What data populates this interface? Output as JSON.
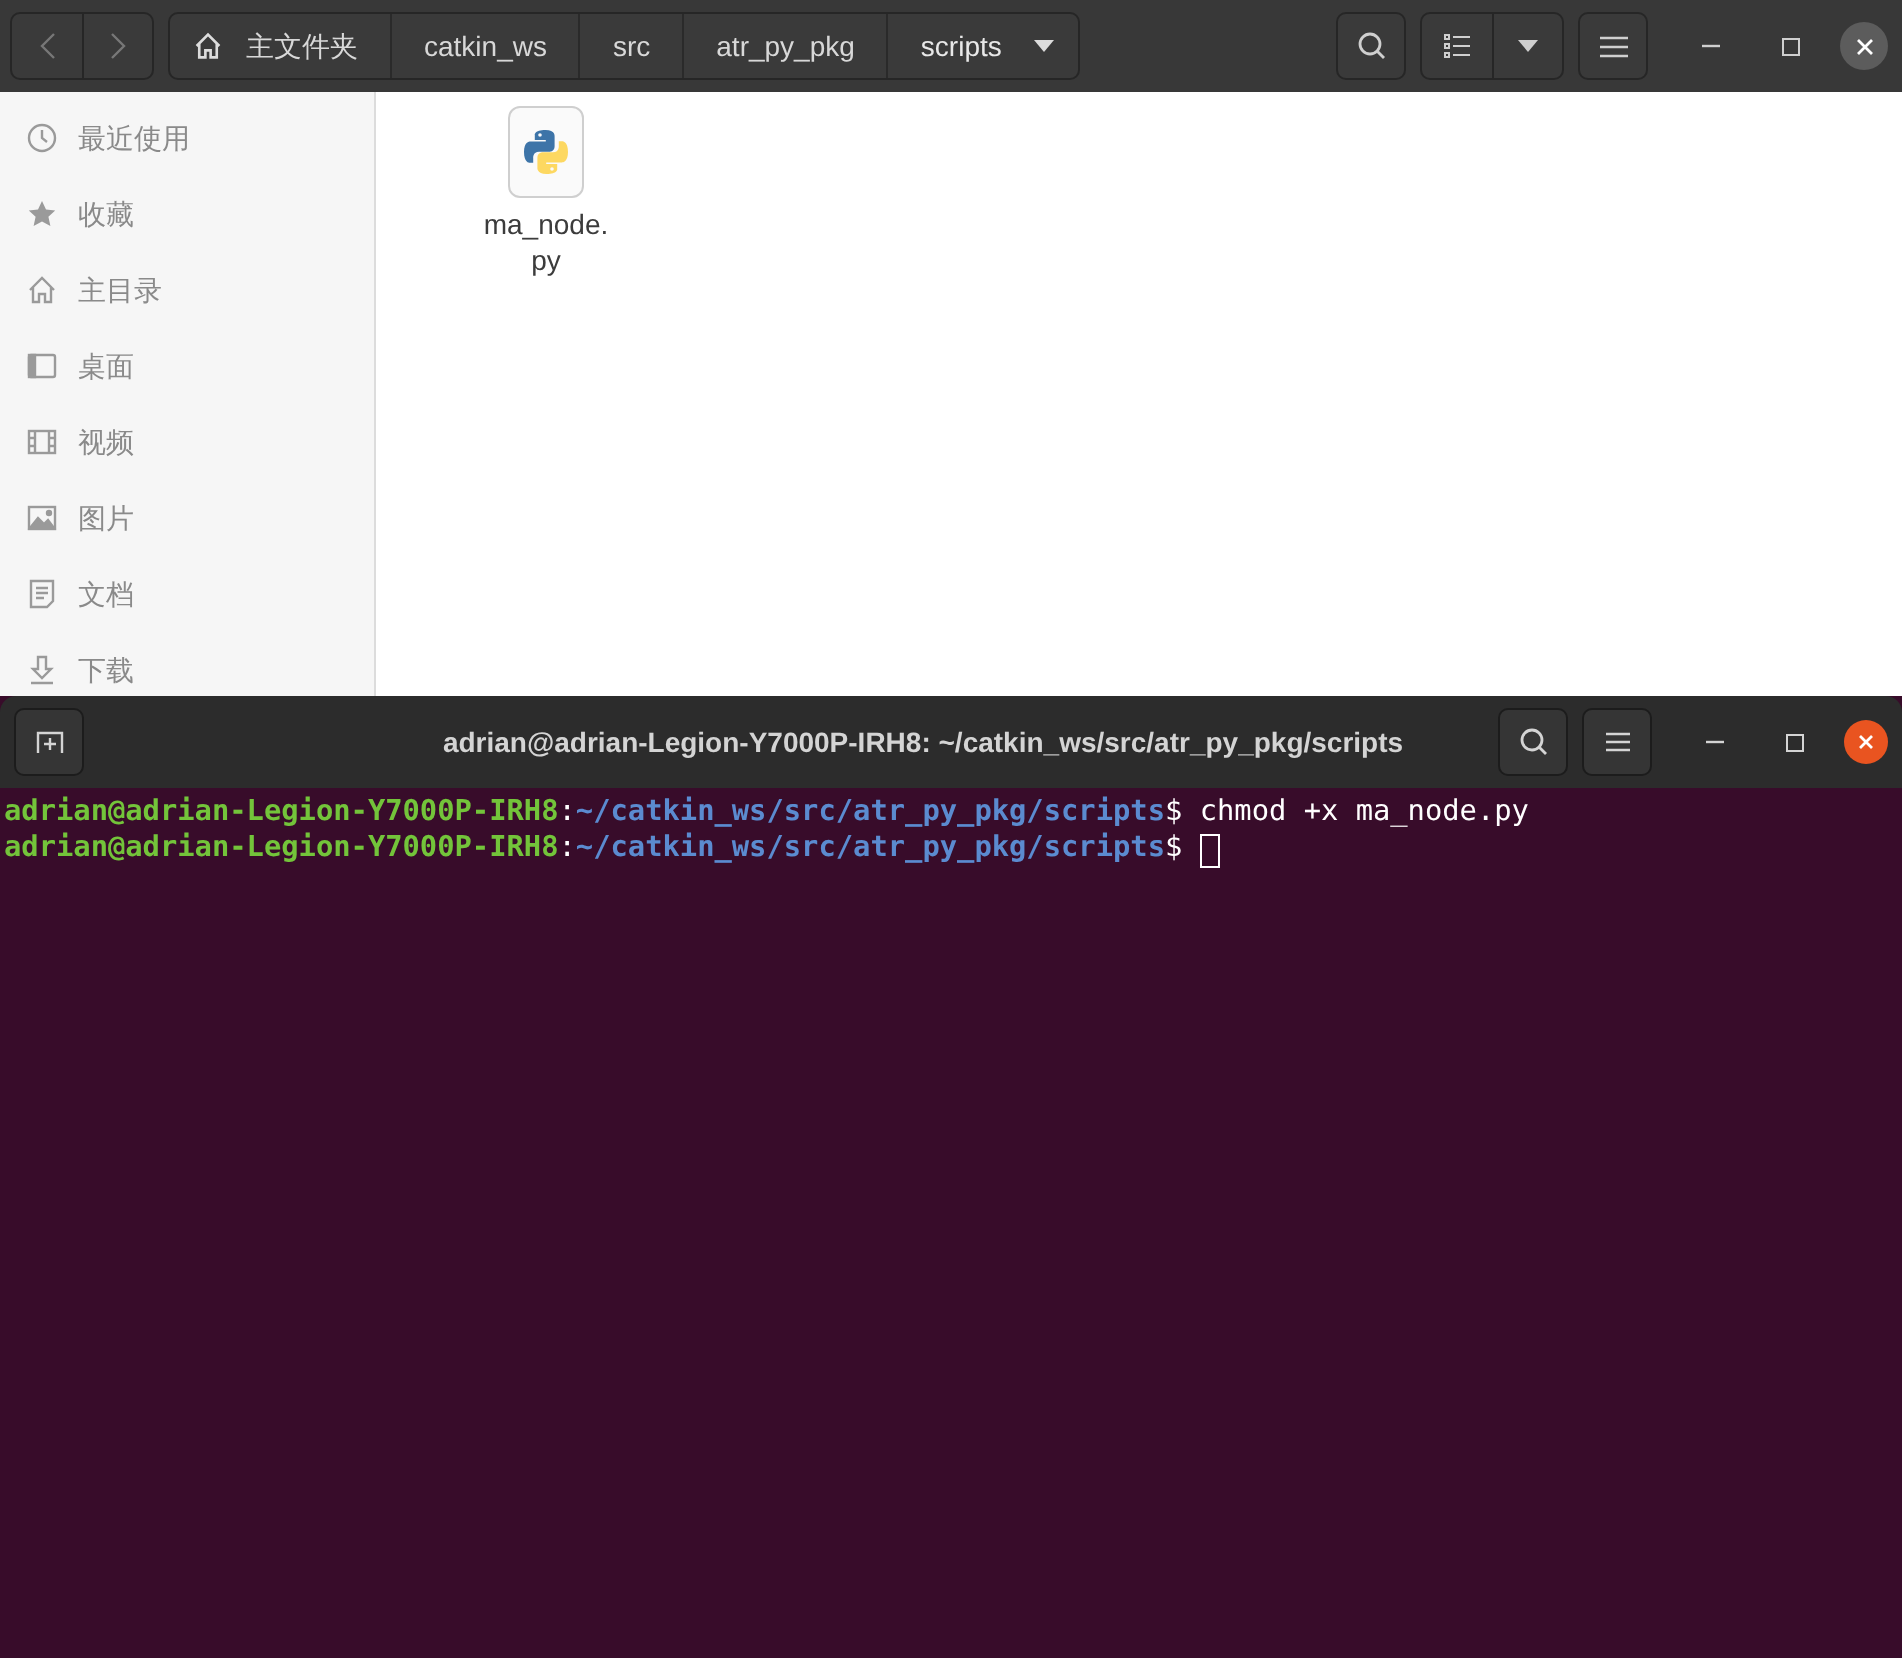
{
  "file_manager": {
    "breadcrumbs": [
      {
        "label": "主文件夹",
        "kind": "home"
      },
      {
        "label": "catkin_ws",
        "kind": "folder"
      },
      {
        "label": "src",
        "kind": "folder"
      },
      {
        "label": "atr_py_pkg",
        "kind": "folder"
      },
      {
        "label": "scripts",
        "kind": "current"
      }
    ],
    "sidebar": {
      "items": [
        {
          "label": "最近使用",
          "kind": "recent"
        },
        {
          "label": "收藏",
          "kind": "starred"
        },
        {
          "label": "主目录",
          "kind": "home"
        },
        {
          "label": "桌面",
          "kind": "desktop"
        },
        {
          "label": "视频",
          "kind": "videos"
        },
        {
          "label": "图片",
          "kind": "pictures"
        },
        {
          "label": "文档",
          "kind": "documents"
        },
        {
          "label": "下载",
          "kind": "downloads"
        }
      ]
    },
    "files": [
      {
        "name": "ma_node.py",
        "kind": "python"
      }
    ]
  },
  "terminal": {
    "title": "adrian@adrian-Legion-Y7000P-IRH8: ~/catkin_ws/src/atr_py_pkg/scripts",
    "lines": [
      {
        "user_host": "adrian@adrian-Legion-Y7000P-IRH8",
        "separator": ":",
        "path": "~/catkin_ws/src/atr_py_pkg/scripts",
        "prompt": "$",
        "command": "chmod +x ma_node.py",
        "cursor": false
      },
      {
        "user_host": "adrian@adrian-Legion-Y7000P-IRH8",
        "separator": ":",
        "path": "~/catkin_ws/src/atr_py_pkg/scripts",
        "prompt": "$",
        "cursor": true
      }
    ]
  }
}
